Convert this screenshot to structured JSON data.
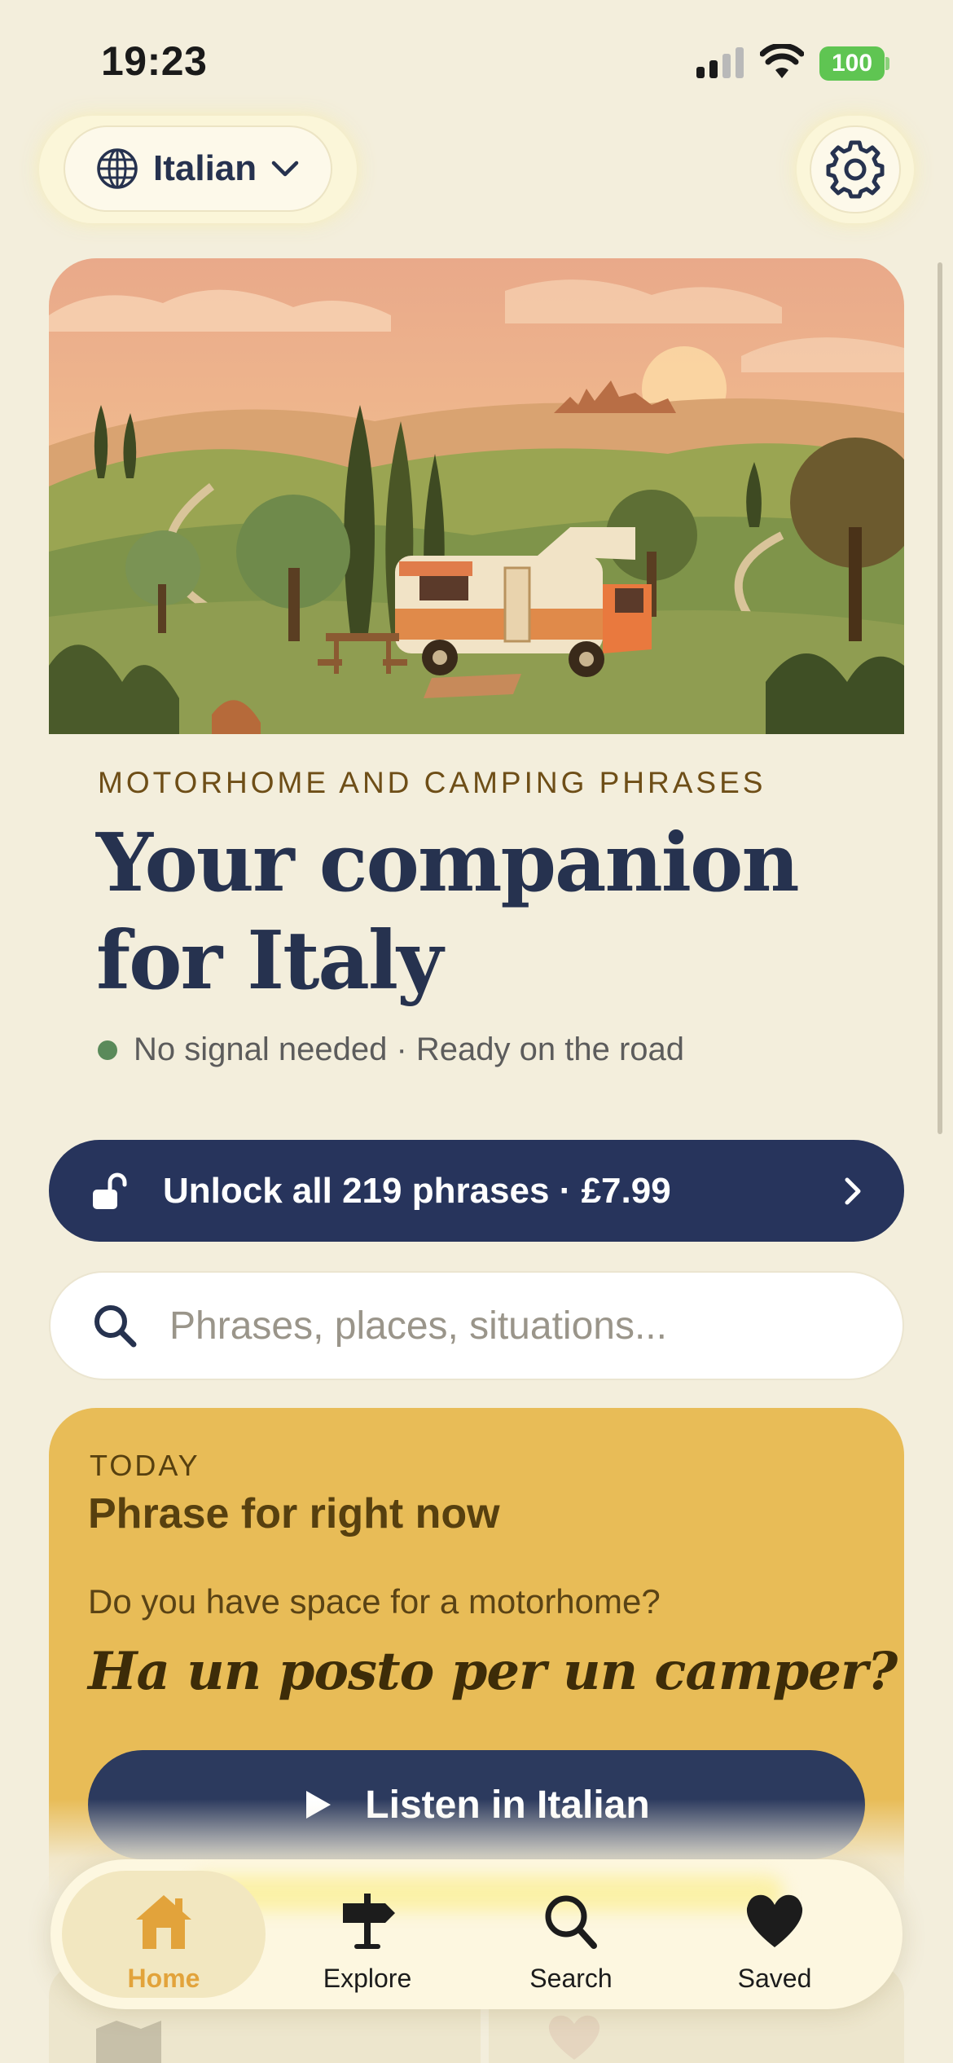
{
  "status_bar": {
    "time": "19:23",
    "battery": "100"
  },
  "header": {
    "language": "Italian"
  },
  "hero": {
    "eyebrow": "MOTORHOME AND CAMPING PHRASES",
    "headline_line1": "Your companion",
    "headline_line2": "for Italy",
    "offline_text": "No signal needed · Ready on the road"
  },
  "unlock": {
    "label": "Unlock all 219 phrases · £7.99"
  },
  "search": {
    "placeholder": "Phrases, places, situations..."
  },
  "phrase_card": {
    "eyebrow": "TODAY",
    "title": "Phrase for right now",
    "english": "Do you have space for a motorhome?",
    "italian": "Ha un posto per un camper?",
    "listen_label": "Listen in Italian"
  },
  "nav": {
    "items": [
      {
        "label": "Home",
        "icon": "home-icon",
        "active": true
      },
      {
        "label": "Explore",
        "icon": "signpost-icon",
        "active": false
      },
      {
        "label": "Search",
        "icon": "search-icon",
        "active": false
      },
      {
        "label": "Saved",
        "icon": "heart-icon",
        "active": false
      }
    ]
  },
  "colors": {
    "background": "#f3eedc",
    "navy": "#27345c",
    "mustard": "#e8bc57",
    "active_nav": "#e2a33b",
    "online_dot": "#5a8a5a",
    "battery": "#5fc552"
  }
}
